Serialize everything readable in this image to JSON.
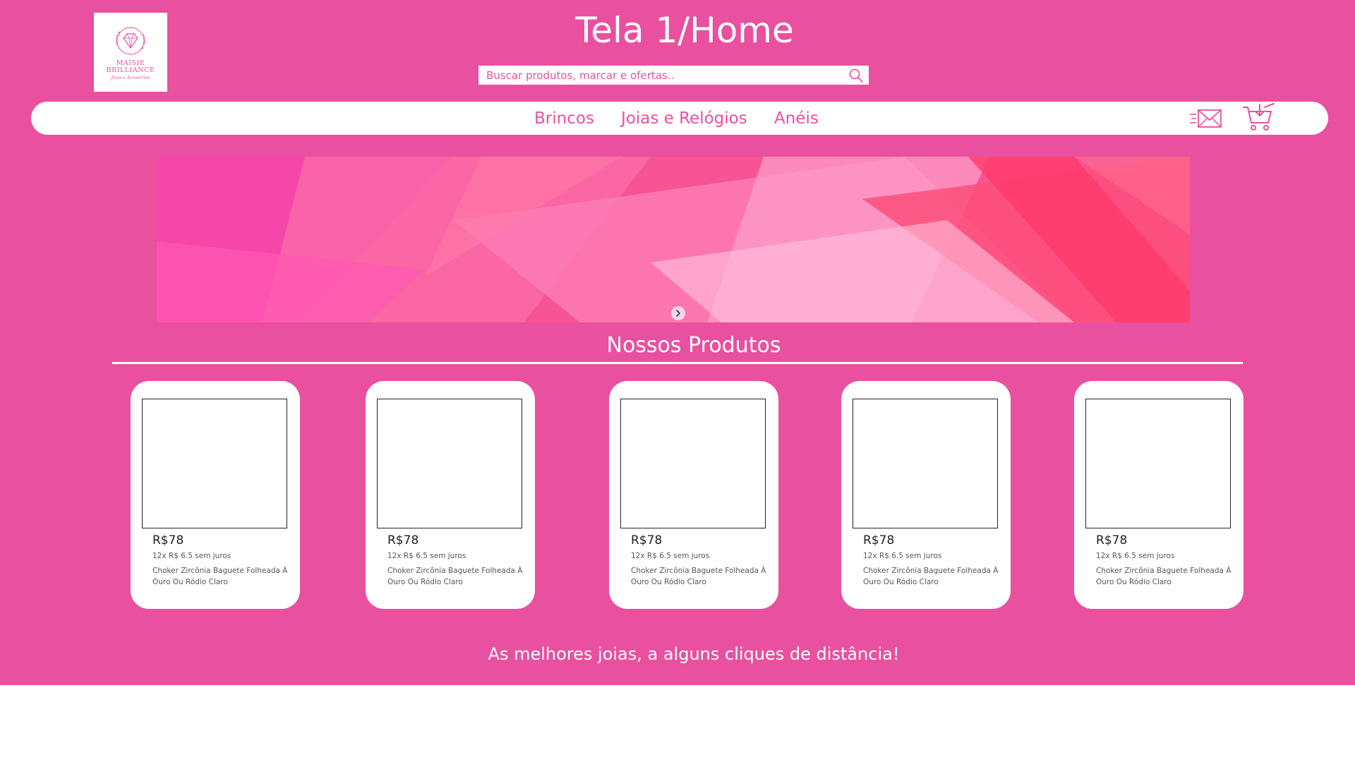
{
  "header": {
    "logo": {
      "brand_line1": "MAISIE",
      "brand_line2": "BRILLIANCE",
      "tagline": "Joias e Acessórios"
    },
    "page_title": "Tela 1/Home",
    "search": {
      "placeholder": "Buscar produtos, marcar e ofertas..",
      "value": "",
      "icon": "search-icon"
    }
  },
  "navbar": {
    "links": [
      "Brincos",
      "Joias e Relógios",
      "Anéis"
    ],
    "icons": [
      "mail-icon",
      "cart-icon"
    ]
  },
  "banner": {
    "next_icon": "chevron-right-icon"
  },
  "products": {
    "title": "Nossos Produtos",
    "items": [
      {
        "price": "R$78",
        "installments": "12x R$ 6.5 sem juros",
        "name": "Choker Zircônia Baguete Folheada À Ouro Ou Ródio Claro"
      },
      {
        "price": "R$78",
        "installments": "12x R$ 6.5 sem juros",
        "name": "Choker Zircônia Baguete Folheada À Ouro Ou Ródio Claro"
      },
      {
        "price": "R$78",
        "installments": "12x R$ 6.5 sem juros",
        "name": "Choker Zircônia Baguete Folheada À Ouro Ou Ródio Claro"
      },
      {
        "price": "R$78",
        "installments": "12x R$ 6.5 sem juros",
        "name": "Choker Zircônia Baguete Folheada À Ouro Ou Ródio Claro"
      },
      {
        "price": "R$78",
        "installments": "12x R$ 6.5 sem juros",
        "name": "Choker Zircônia Baguete Folheada À Ouro Ou Ródio Claro"
      }
    ]
  },
  "footer": {
    "tagline": "As melhores joias, a alguns cliques de distância!"
  },
  "colors": {
    "primary": "#e9509f",
    "surface": "#ffffff",
    "text_dark": "#222222"
  }
}
